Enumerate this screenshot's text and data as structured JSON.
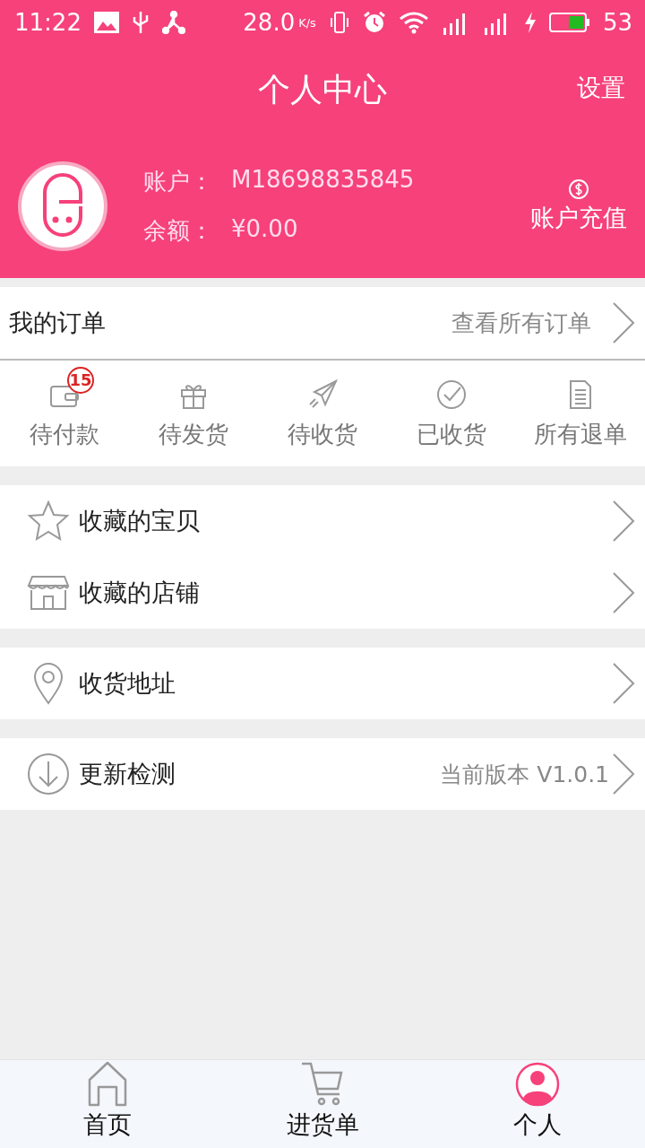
{
  "status_bar": {
    "time": "11:22",
    "speed": "28.0",
    "speed_unit": "K/s",
    "battery": "53"
  },
  "header": {
    "title": "个人中心",
    "settings": "设置"
  },
  "profile": {
    "account_label": "账户：",
    "account": "M18698835845",
    "balance_label": "余额：",
    "balance": "¥0.00",
    "recharge": "账户充值"
  },
  "orders": {
    "title": "我的订单",
    "view_all": "查看所有订单",
    "shortcuts": [
      {
        "kind": "wallet",
        "label": "待付款",
        "badge": "15"
      },
      {
        "kind": "gift",
        "label": "待发货"
      },
      {
        "kind": "plane",
        "label": "待收货"
      },
      {
        "kind": "check",
        "label": "已收货"
      },
      {
        "kind": "document",
        "label": "所有退单"
      }
    ]
  },
  "menu_groups": [
    {
      "items": [
        {
          "kind": "star",
          "label": "收藏的宝贝"
        },
        {
          "kind": "shop",
          "label": "收藏的店铺"
        }
      ]
    },
    {
      "items": [
        {
          "kind": "pin",
          "label": "收货地址"
        }
      ]
    },
    {
      "items": [
        {
          "kind": "download",
          "label": "更新检测",
          "value": "当前版本 V1.0.1"
        }
      ]
    }
  ],
  "tab_bar": [
    {
      "kind": "home",
      "label": "首页",
      "selected": false
    },
    {
      "kind": "cart",
      "label": "进货单",
      "selected": false
    },
    {
      "kind": "person",
      "label": "个人",
      "selected": true
    }
  ]
}
